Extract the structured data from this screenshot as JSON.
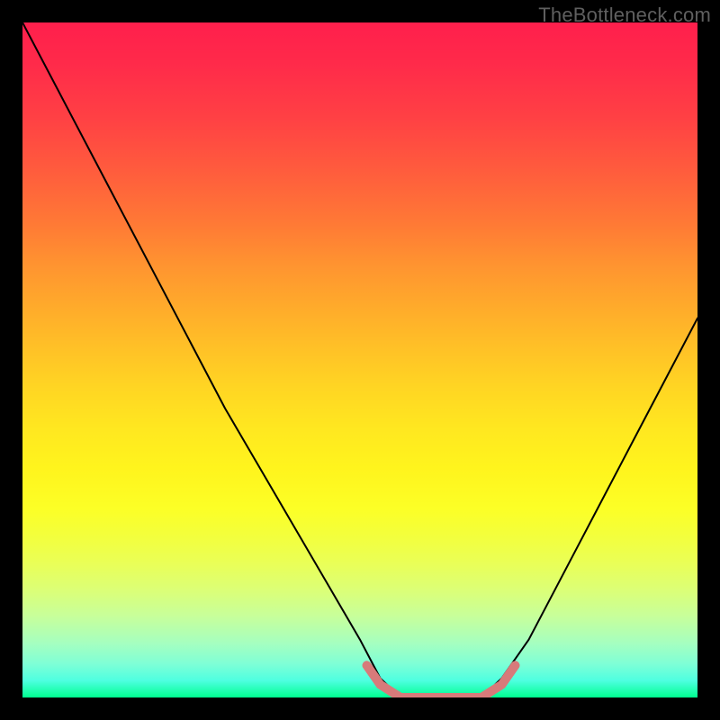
{
  "watermark": "TheBottleneck.com",
  "chart_data": {
    "type": "line",
    "title": "",
    "xlabel": "",
    "ylabel": "",
    "xlim": [
      0,
      1
    ],
    "ylim": [
      0,
      1.05
    ],
    "background_gradient": {
      "top_color": "#ff1f4c",
      "bottom_color": "#00ff90",
      "meaning": "absolute value heatmap, red=high, green=low"
    },
    "series": [
      {
        "name": "bottleneck-curve",
        "color": "#000000",
        "x": [
          0.0,
          0.05,
          0.1,
          0.15,
          0.2,
          0.25,
          0.3,
          0.35,
          0.4,
          0.45,
          0.5,
          0.53,
          0.56,
          0.6,
          0.64,
          0.68,
          0.71,
          0.75,
          0.8,
          0.85,
          0.9,
          0.95,
          1.0
        ],
        "values": [
          1.05,
          0.95,
          0.85,
          0.75,
          0.65,
          0.55,
          0.45,
          0.36,
          0.27,
          0.18,
          0.09,
          0.03,
          0.0,
          0.0,
          0.0,
          0.0,
          0.03,
          0.09,
          0.19,
          0.29,
          0.39,
          0.49,
          0.59
        ]
      },
      {
        "name": "highlight-band",
        "color": "#d77a7a",
        "stroke_width": 10,
        "x": [
          0.51,
          0.53,
          0.56,
          0.6,
          0.64,
          0.68,
          0.71,
          0.73
        ],
        "values": [
          0.05,
          0.02,
          0.0,
          0.0,
          0.0,
          0.0,
          0.02,
          0.05
        ]
      }
    ]
  }
}
